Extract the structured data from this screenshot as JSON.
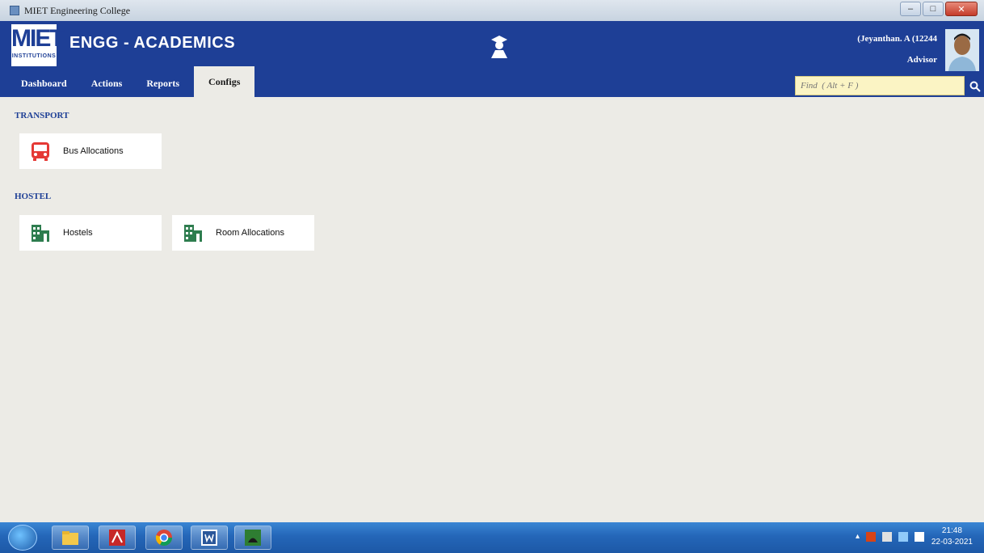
{
  "window": {
    "title": "MIET Engineering College",
    "controls": {
      "minimize": "–",
      "maximize": "□",
      "close": "✕"
    }
  },
  "header": {
    "logo_text": "MIET",
    "logo_subtext": "INSTITUTIONS",
    "app_title": "ENGG - ACADEMICS",
    "user_name": "(Jeyanthan. A (12244",
    "user_role": "Advisor"
  },
  "nav": {
    "tabs": [
      {
        "label": "Dashboard"
      },
      {
        "label": "Actions"
      },
      {
        "label": "Reports"
      },
      {
        "label": "Configs"
      }
    ],
    "active": "Configs"
  },
  "search": {
    "placeholder": "Find  ( Alt + F )"
  },
  "sections": {
    "transport": {
      "title": "TRANSPORT",
      "items": [
        {
          "label": "Bus Allocations",
          "icon": "bus-icon"
        }
      ]
    },
    "hostel": {
      "title": "HOSTEL",
      "items": [
        {
          "label": "Hostels",
          "icon": "building-icon"
        },
        {
          "label": "Room Allocations",
          "icon": "building-icon"
        }
      ]
    }
  },
  "taskbar": {
    "time": "21:48",
    "date": "22-03-2021",
    "apps": [
      "file-explorer-icon",
      "pdf-reader-icon",
      "chrome-icon",
      "word-icon",
      "app-icon"
    ]
  },
  "colors": {
    "header_bg": "#1e3f96",
    "content_bg": "#ecebe6",
    "bus_red": "#e53935",
    "building_green": "#2e7d4f",
    "search_bg": "#fbf4c4"
  }
}
